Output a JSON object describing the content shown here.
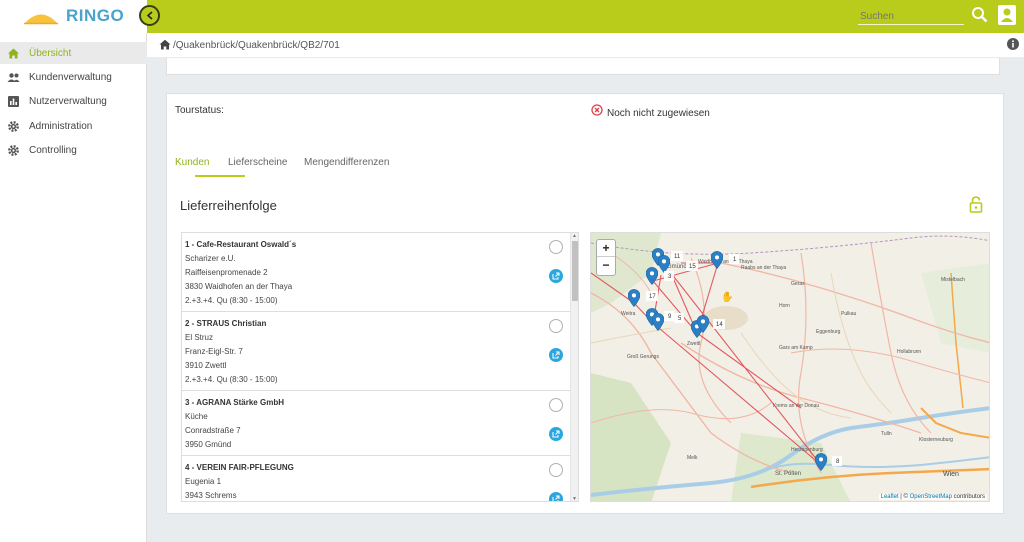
{
  "header": {
    "logo_text": "RINGO",
    "search_placeholder": "Suchen"
  },
  "sidebar": {
    "items": [
      {
        "label": "Übersicht",
        "icon": "home-icon"
      },
      {
        "label": "Kundenverwaltung",
        "icon": "people-icon"
      },
      {
        "label": "Nutzerverwaltung",
        "icon": "chart-icon"
      },
      {
        "label": "Administration",
        "icon": "gear-icon"
      },
      {
        "label": "Controlling",
        "icon": "gear-icon"
      }
    ]
  },
  "breadcrumb": "/Quakenbrück/Quakenbrück/QB2/701",
  "tour": {
    "status_label": "Tourstatus:",
    "status_value": "Noch nicht zugewiesen"
  },
  "tabs": [
    {
      "label": "Kunden",
      "active": true
    },
    {
      "label": "Lieferscheine",
      "active": false
    },
    {
      "label": "Mengendifferenzen",
      "active": false
    }
  ],
  "section_title": "Lieferreihenfolge",
  "deliveries": [
    {
      "title": "1 - Cafe-Restaurant Oswald´s",
      "lines": [
        "Scharizer e.U.",
        "Raiffeisenpromenade 2",
        "3830 Waidhofen an der Thaya",
        "2.+3.+4. Qu (8:30 - 15:00)"
      ]
    },
    {
      "title": "2 - STRAUS Christian",
      "lines": [
        "El Struz",
        "Franz-Eigl-Str. 7",
        "3910 Zwettl",
        "2.+3.+4. Qu (8:30 - 15:00)"
      ]
    },
    {
      "title": "3 - AGRANA Stärke GmbH",
      "lines": [
        "Küche",
        "Conradstraße 7",
        "3950 Gmünd"
      ]
    },
    {
      "title": "4 - VEREIN FAIR-PFLEGUNG",
      "lines": [
        "Eugenia 1",
        "3943 Schrems"
      ]
    }
  ],
  "map": {
    "zoom_in": "+",
    "zoom_out": "−",
    "attribution_leaflet": "Leaflet",
    "attribution_sep": " | © ",
    "attribution_osm": "OpenStreetMap",
    "attribution_rest": " contributors",
    "marker_labels": [
      "11",
      "15",
      "1",
      "3",
      "17",
      "9",
      "5",
      "14",
      "8"
    ],
    "place_labels": [
      "Waidhofen an der Thaya",
      "Zwettl",
      "Gmünd",
      "Groß Gerungs",
      "Gars am Kamp",
      "Krems an der Donau",
      "St. Pölten",
      "Herzogenburg",
      "Wien",
      "Horn",
      "Eggenburg",
      "Hollabrunn",
      "Tulln",
      "Klosterneuburg",
      "Melk",
      "Raabs an der Thaya",
      "Geras",
      "Pulkau",
      "Weitra",
      "Mistelbach"
    ]
  },
  "colors": {
    "brand_green": "#b9cc1c",
    "accent_blue": "#2aa7df",
    "route_red": "#e0404a",
    "marker_blue": "#2b7fc4"
  }
}
